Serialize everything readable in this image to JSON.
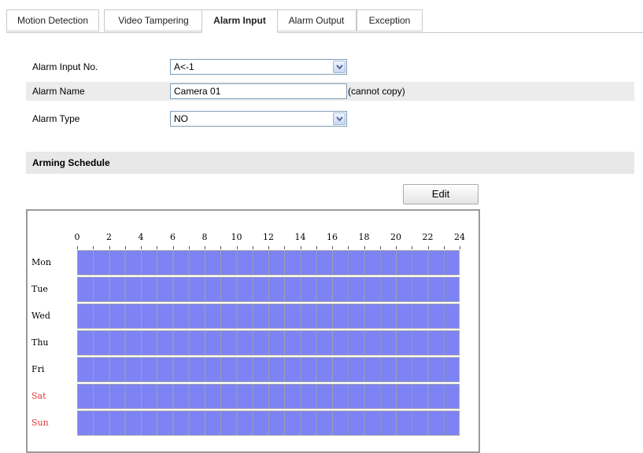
{
  "tabs": [
    {
      "label": "Motion Detection",
      "active": false
    },
    {
      "label": "Video Tampering",
      "active": false
    },
    {
      "label": "Alarm Input",
      "active": true
    },
    {
      "label": "Alarm Output",
      "active": false
    },
    {
      "label": "Exception",
      "active": false
    }
  ],
  "form": {
    "alarm_input_no": {
      "label": "Alarm Input No.",
      "value": "A<-1"
    },
    "alarm_name": {
      "label": "Alarm Name",
      "value": "Camera 01",
      "note": "(cannot copy)"
    },
    "alarm_type": {
      "label": "Alarm Type",
      "value": "NO"
    }
  },
  "arming_schedule": {
    "title": "Arming Schedule",
    "edit_label": "Edit",
    "hour_labels": [
      "0",
      "2",
      "4",
      "6",
      "8",
      "10",
      "12",
      "14",
      "16",
      "18",
      "20",
      "22",
      "24"
    ],
    "days": [
      {
        "label": "Mon",
        "weekend": false,
        "armed_hours": [
          0,
          24
        ]
      },
      {
        "label": "Tue",
        "weekend": false,
        "armed_hours": [
          0,
          24
        ]
      },
      {
        "label": "Wed",
        "weekend": false,
        "armed_hours": [
          0,
          24
        ]
      },
      {
        "label": "Thu",
        "weekend": false,
        "armed_hours": [
          0,
          24
        ]
      },
      {
        "label": "Fri",
        "weekend": false,
        "armed_hours": [
          0,
          24
        ]
      },
      {
        "label": "Sat",
        "weekend": true,
        "armed_hours": [
          0,
          24
        ]
      },
      {
        "label": "Sun",
        "weekend": true,
        "armed_hours": [
          0,
          24
        ]
      }
    ]
  },
  "colors": {
    "armed": "#7d83f4",
    "weekend_label": "#e03c3c",
    "shaded_row": "#ececec"
  }
}
